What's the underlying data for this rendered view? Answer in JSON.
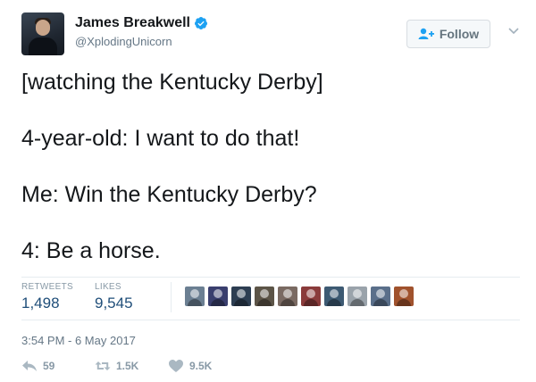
{
  "header": {
    "name": "James Breakwell",
    "handle": "@XplodingUnicorn",
    "follow_label": "Follow",
    "verified": true
  },
  "tweet": {
    "lines": [
      "[watching the Kentucky Derby]",
      "4-year-old: I want to do that!",
      "Me: Win the Kentucky Derby?",
      "4: Be a horse."
    ]
  },
  "stats": {
    "retweets_label": "RETWEETS",
    "retweets_value": "1,498",
    "likes_label": "LIKES",
    "likes_value": "9,545"
  },
  "likers": {
    "colors": [
      "#6b7f92",
      "#3a3f6e",
      "#2d3e52",
      "#5c5447",
      "#7a6a62",
      "#8a3b3b",
      "#3d5a73",
      "#9aa3ab",
      "#5a6f8a",
      "#a0522d"
    ]
  },
  "timestamp": "3:54 PM - 6 May 2017",
  "actions": {
    "reply_count": "59",
    "retweet_count": "1.5K",
    "like_count": "9.5K"
  },
  "colors": {
    "verified_blue": "#1da1f2",
    "link_blue": "#1f4e79",
    "muted": "#8899a6"
  }
}
